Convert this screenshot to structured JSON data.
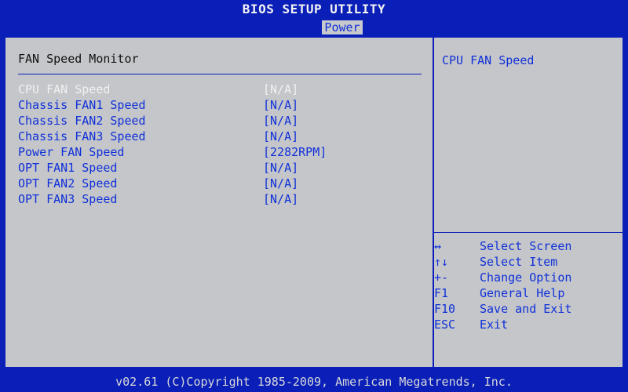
{
  "header": {
    "title": "BIOS SETUP UTILITY",
    "active_tab": "Power"
  },
  "main": {
    "section_title": "FAN Speed Monitor",
    "rows": [
      {
        "label": "CPU FAN Speed",
        "value": "[N/A]",
        "selected": true
      },
      {
        "label": "Chassis FAN1 Speed",
        "value": "[N/A]"
      },
      {
        "label": "Chassis FAN2 Speed",
        "value": "[N/A]"
      },
      {
        "label": "Chassis FAN3 Speed",
        "value": "[N/A]"
      },
      {
        "label": "Power FAN Speed",
        "value": "[2282RPM]"
      },
      {
        "label": "OPT FAN1 Speed",
        "value": "[N/A]"
      },
      {
        "label": "OPT FAN2 Speed",
        "value": "[N/A]"
      },
      {
        "label": "OPT FAN3 Speed",
        "value": "[N/A]"
      }
    ]
  },
  "help": {
    "title": "CPU FAN Speed",
    "keys": [
      {
        "key": "↔",
        "desc": "Select Screen"
      },
      {
        "key": "↑↓",
        "desc": "Select Item"
      },
      {
        "key": "+-",
        "desc": "Change Option"
      },
      {
        "key": "F1",
        "desc": "General Help"
      },
      {
        "key": "F10",
        "desc": "Save and Exit"
      },
      {
        "key": "ESC",
        "desc": "Exit"
      }
    ]
  },
  "footer": {
    "text": "v02.61 (C)Copyright 1985-2009, American Megatrends, Inc."
  },
  "colors": {
    "background": "#0a1fb8",
    "panel": "#c4c6ca",
    "text_blue": "#1030d8",
    "text_selected": "#f1f1f1"
  }
}
